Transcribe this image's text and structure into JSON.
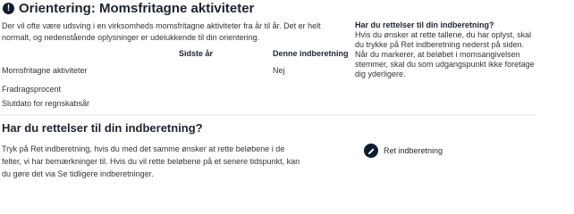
{
  "header": {
    "icon": "info-icon",
    "title": "Orientering: Momsfritagne aktiviteter"
  },
  "intro": "Der vil ofte være udsving i en virksomheds momsfritagne aktiviteter fra år til år. Det er helt normalt, og nedenstående oplysninger er udelukkende til din orientering.",
  "table": {
    "columns": [
      "Sidste år",
      "Denne indberetning"
    ],
    "rows": [
      {
        "label": "Momsfritagne aktiviteter",
        "last_year": "",
        "this": "Nej"
      },
      {
        "label": "Fradragsprocent",
        "last_year": "",
        "this": ""
      },
      {
        "label": "Slutdato for regnskabsår",
        "last_year": "",
        "this": ""
      }
    ]
  },
  "side": {
    "title": "Har du rettelser til din indberetning?",
    "p1": "Hvis du ønsker at rette tallene, du har oplyst, skal du trykke på Ret indberetning nederst på siden.",
    "p2": "Når du markerer, at beløbet i momsangivelsen stemmer, skal du som udgangspunkt ikke foretage dig yderligere."
  },
  "section2": {
    "title": "Har du rettelser til din indberetning?",
    "text": "Tryk på Ret indberetning, hvis du med det samme ønsker at rette beløbene i de felter, vi har bemærkninger til. Hvis du vil rette beløbene på et senere tidspunkt, kan du gøre det via Se tidligere indberetninger.",
    "button_label": "Ret indberetning",
    "button_icon": "pencil-icon"
  }
}
